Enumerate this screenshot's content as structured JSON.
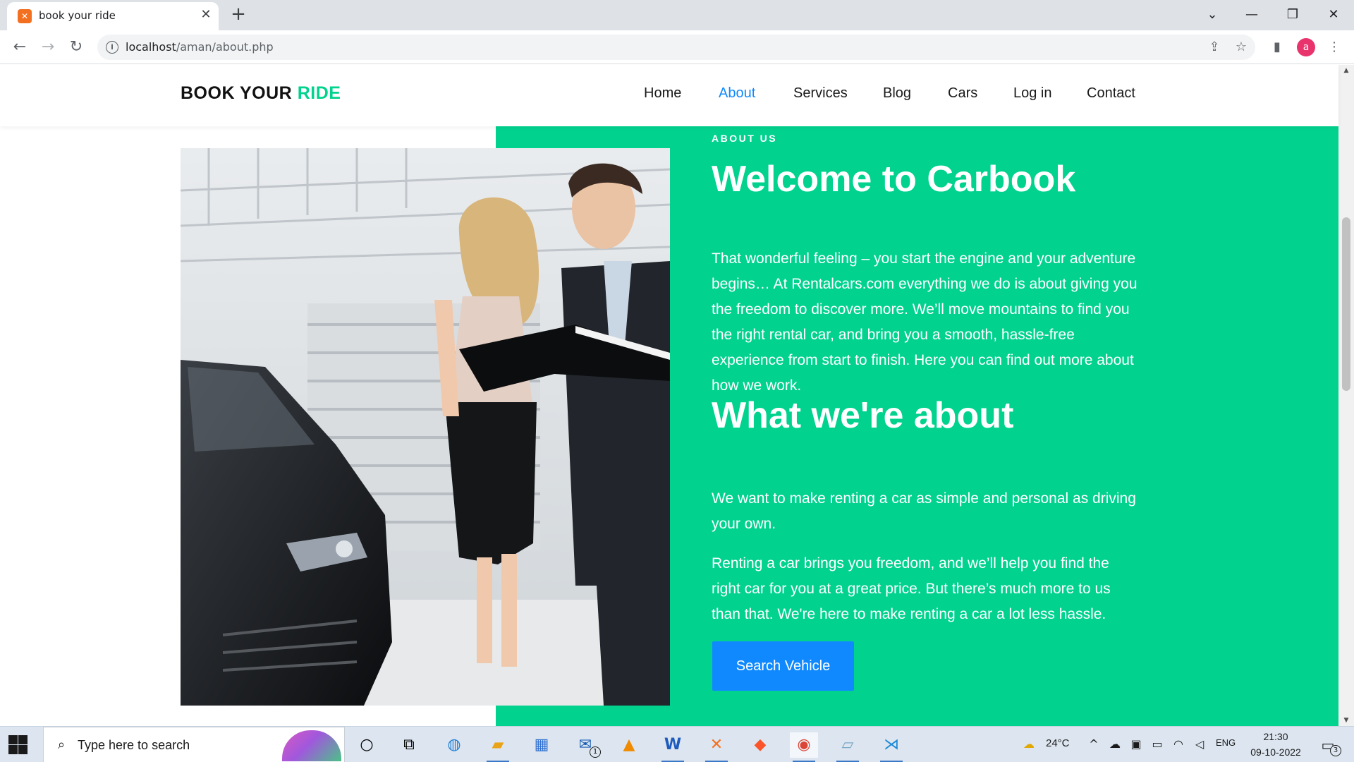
{
  "browser": {
    "tab_title": "book your ride",
    "tab_favicon": "xampp-icon",
    "url_host": "localhost",
    "url_path": "/aman/about.php",
    "profile_initial": "a"
  },
  "site": {
    "logo_main": "BOOK YOUR",
    "logo_accent": "RIDE",
    "accent_color": "#01d28e",
    "link_active_color": "#1089ff",
    "nav": [
      {
        "label": "Home",
        "active": false
      },
      {
        "label": "About",
        "active": true
      },
      {
        "label": "Services",
        "active": false
      },
      {
        "label": "Blog",
        "active": false
      },
      {
        "label": "Cars",
        "active": false
      },
      {
        "label": "Log in",
        "active": false
      },
      {
        "label": "Contact",
        "active": false
      }
    ]
  },
  "about": {
    "eyebrow": "ABOUT US",
    "heading": "Welcome to Carbook",
    "paragraph1": "That wonderful feeling – you start the engine and your adventure begins… At Rentalcars.com everything we do is about giving you the freedom to discover more. We’ll move mountains to find you the right rental car, and bring you a smooth, hassle-free experience from start to finish. Here you can find out more about how we work.",
    "heading2": "What we're about",
    "paragraph2": "We want to make renting a car as simple and personal as driving your own.",
    "paragraph3": "Renting a car brings you freedom, and we’ll help you find the right car for you at a great price. But there’s much more to us than that. We're here to make renting a car a lot less hassle.",
    "cta_label": "Search Vehicle"
  },
  "taskbar": {
    "search_placeholder": "Type here to search",
    "weather": "24°C",
    "language": "ENG",
    "time": "21:30",
    "date": "09-10-2022",
    "notification_count": "3",
    "mail_badge": "1"
  }
}
